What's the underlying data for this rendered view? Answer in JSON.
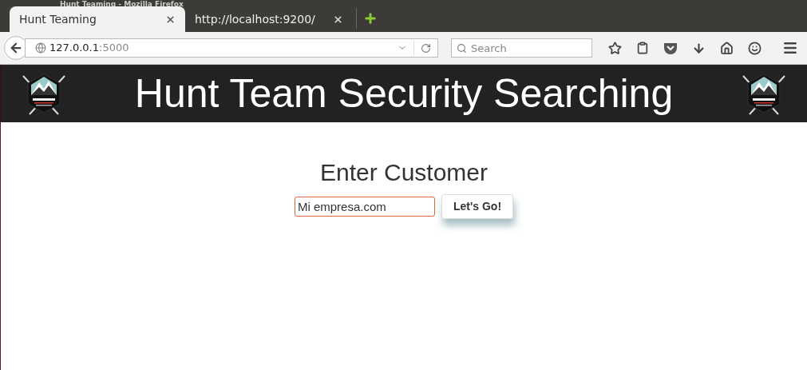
{
  "window": {
    "title": "Hunt Teaming - Mozilla Firefox"
  },
  "tabs": [
    {
      "label": "Hunt Teaming",
      "selected": true
    },
    {
      "label": "http://localhost:9200/",
      "selected": false
    }
  ],
  "address_bar": {
    "host": "127.0.0.1",
    "port": ":5000"
  },
  "search": {
    "placeholder": "Search"
  },
  "page": {
    "heading": "Hunt Team Security Searching",
    "form_title": "Enter Customer",
    "customer_field": {
      "value": "Mi empresa.com"
    },
    "submit_button": "Let's Go!"
  }
}
